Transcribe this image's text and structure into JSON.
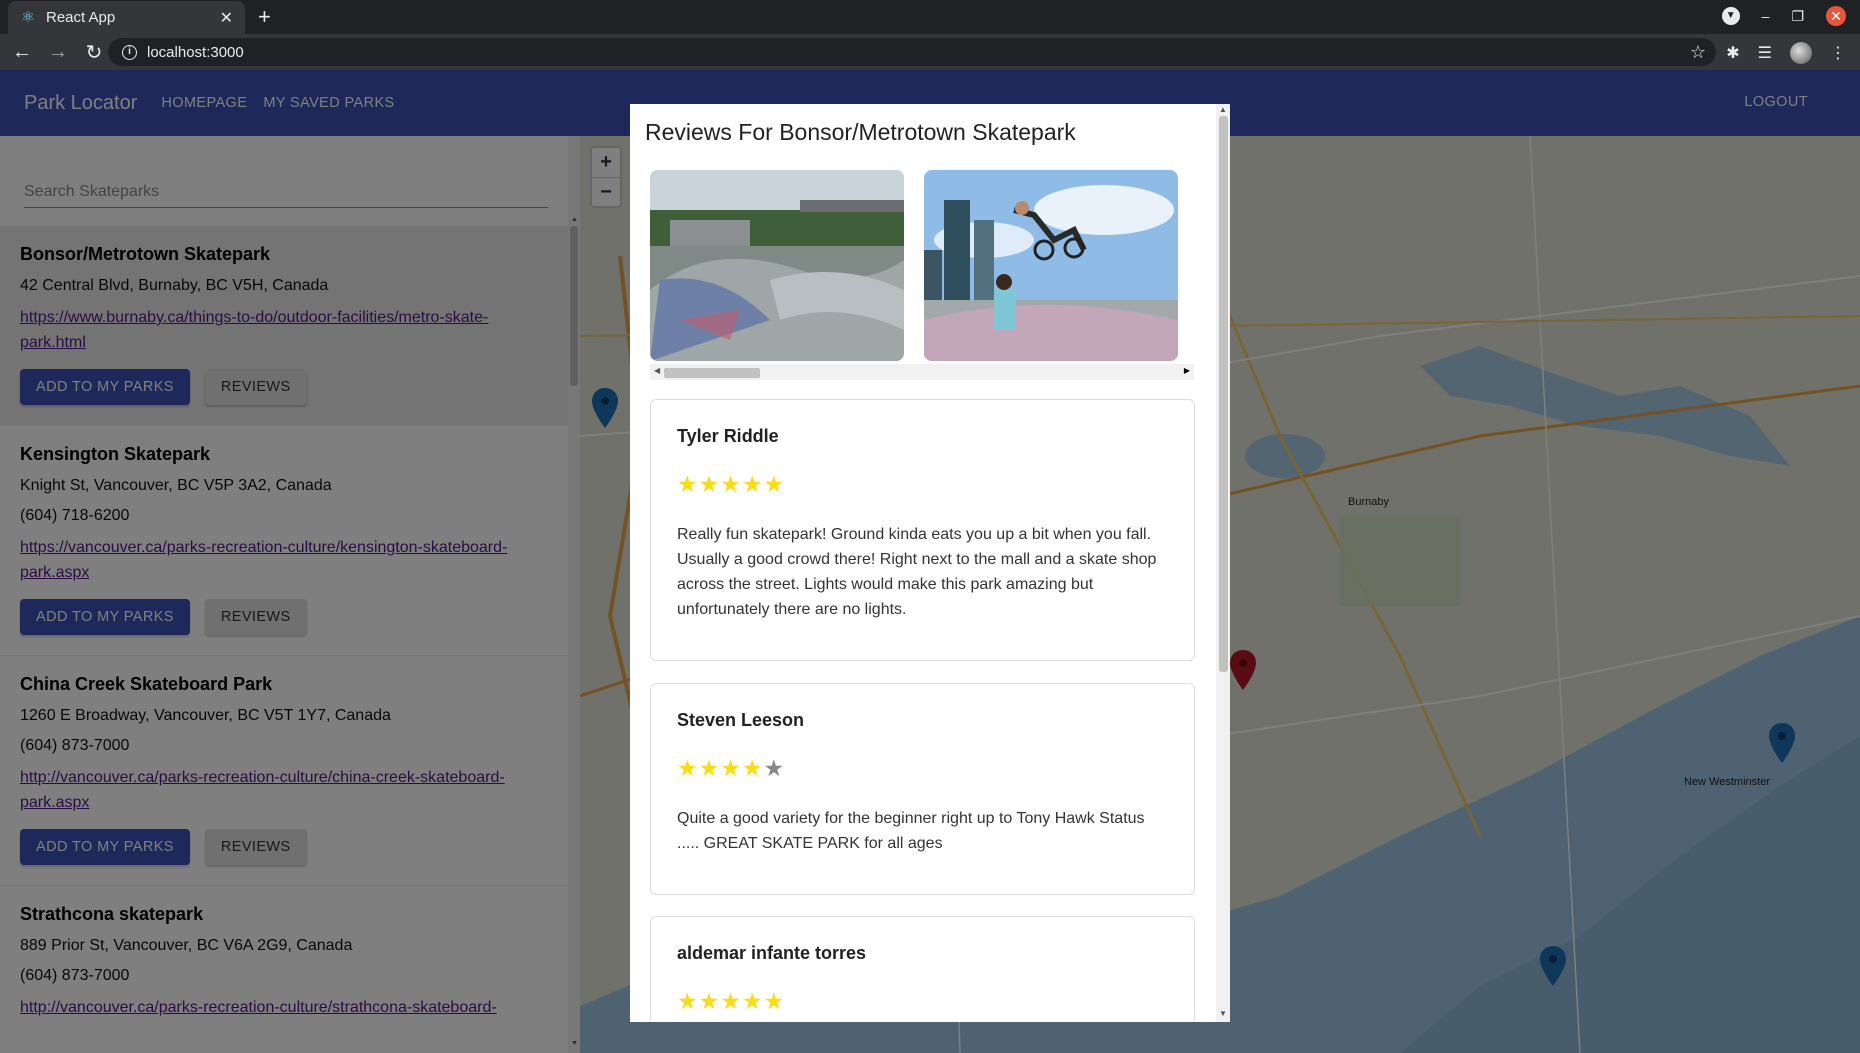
{
  "browser": {
    "tab_title": "React App",
    "url": "localhost:3000"
  },
  "app": {
    "brand": "Park Locator",
    "nav": [
      "HOMEPAGE",
      "MY SAVED PARKS"
    ],
    "logout": "LOGOUT",
    "search_placeholder": "Search Skateparks",
    "add_label": "ADD TO MY PARKS",
    "reviews_label": "REVIEWS",
    "parks": [
      {
        "name": "Bonsor/Metrotown Skatepark",
        "address": "42 Central Blvd, Burnaby, BC V5H, Canada",
        "phone": "",
        "link": "https://www.burnaby.ca/things-to-do/outdoor-facilities/metro-skate-park.html"
      },
      {
        "name": "Kensington Skatepark",
        "address": "Knight St, Vancouver, BC V5P 3A2, Canada",
        "phone": "(604) 718-6200",
        "link": "https://vancouver.ca/parks-recreation-culture/kensington-skateboard-park.aspx"
      },
      {
        "name": "China Creek Skateboard Park",
        "address": "1260 E Broadway, Vancouver, BC V5T 1Y7, Canada",
        "phone": "(604) 873-7000",
        "link": "http://vancouver.ca/parks-recreation-culture/china-creek-skateboard-park.aspx"
      },
      {
        "name": "Strathcona skatepark",
        "address": "889 Prior St, Vancouver, BC V6A 2G9, Canada",
        "phone": "(604) 873-7000",
        "link": "http://vancouver.ca/parks-recreation-culture/strathcona-skateboard-"
      }
    ]
  },
  "map": {
    "labels": [
      "Burnaby",
      "New Westminster"
    ],
    "zoom_in": "+",
    "zoom_out": "−"
  },
  "modal": {
    "title": "Reviews For Bonsor/Metrotown Skatepark",
    "reviews": [
      {
        "author": "Tyler Riddle",
        "rating": 5,
        "text": "Really fun skatepark! Ground kinda eats you up a bit when you fall. Usually a good crowd there! Right next to the mall and a skate shop across the street. Lights would make this park amazing but unfortunately there are no lights."
      },
      {
        "author": "Steven Leeson",
        "rating": 4,
        "text": "Quite a good variety for the beginner right up to Tony Hawk Status ..... GREAT SKATE PARK for all ages"
      },
      {
        "author": "aldemar infante torres",
        "rating": 5,
        "text": ""
      }
    ]
  },
  "colors": {
    "primary": "#3f51b5",
    "star": "#fadb14",
    "star_empty": "#888888",
    "link": "#551a8b"
  }
}
